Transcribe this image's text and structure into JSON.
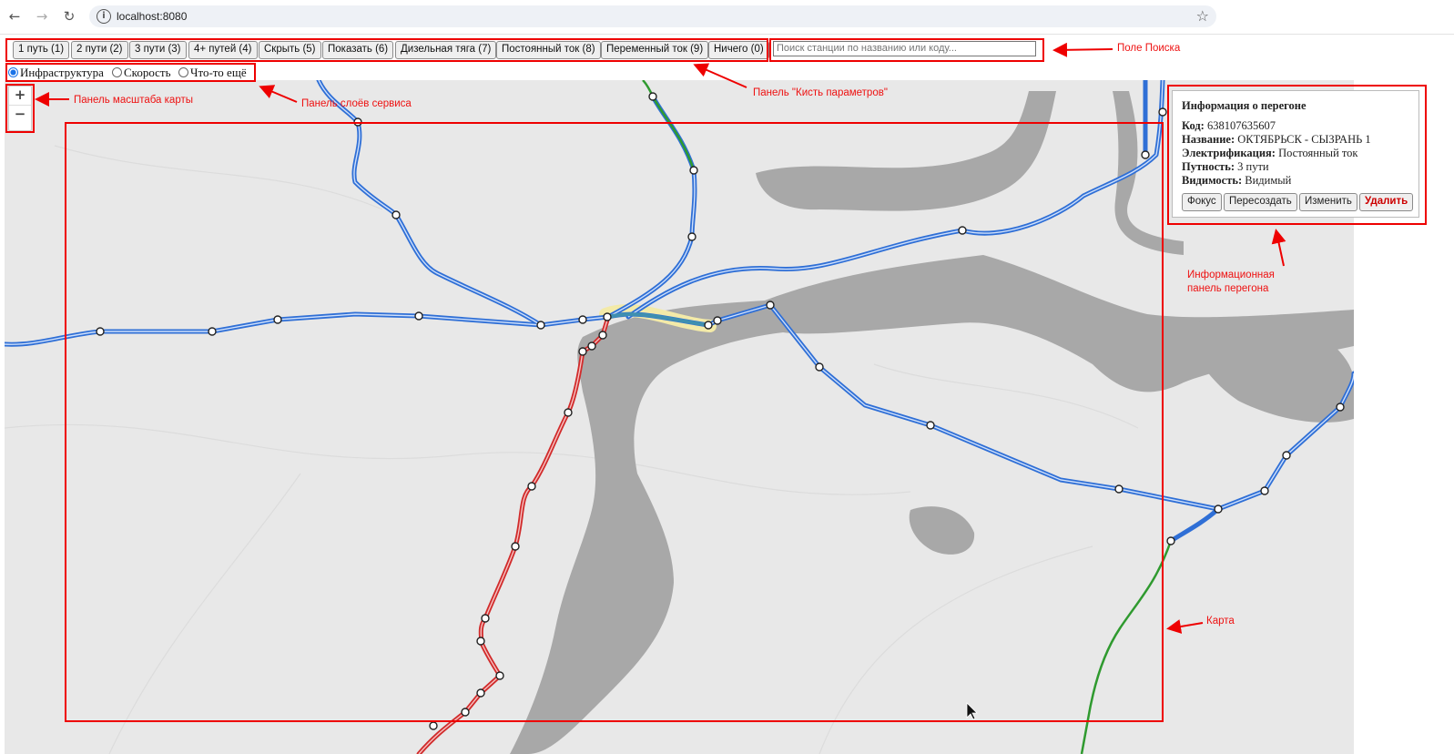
{
  "browser": {
    "back_icon": "arrow-left-icon",
    "forward_icon": "arrow-right-icon",
    "reload_icon": "reload-icon",
    "url": "localhost:8080",
    "bookmark_icon": "star-icon"
  },
  "toolbar": {
    "buttons": [
      "1 путь (1)",
      "2 пути (2)",
      "3 пути (3)",
      "4+ путей (4)",
      "Скрыть (5)",
      "Показать (6)",
      "Дизельная тяга (7)",
      "Постоянный ток (8)",
      "Переменный ток (9)",
      "Ничего (0)"
    ],
    "search_placeholder": "Поиск станции по названию или коду..."
  },
  "layers": {
    "options": [
      "Инфраструктура",
      "Скорость",
      "Что-то ещё"
    ],
    "selected": "Инфраструктура"
  },
  "zoom": {
    "plus": "+",
    "minus": "−"
  },
  "info_panel": {
    "title": "Информация о перегоне",
    "code_label": "Код:",
    "code": "638107635607",
    "name_label": "Название:",
    "name": "ОКТЯБРЬСК - СЫЗРАНЬ 1",
    "electrification_label": "Электрификация:",
    "electrification": "Постоянный ток",
    "tracks_label": "Путность:",
    "tracks": "3 пути",
    "visibility_label": "Видимость:",
    "visibility": "Видимый",
    "buttons": {
      "focus": "Фокус",
      "recreate": "Пересоздать",
      "edit": "Изменить",
      "delete": "Удалить"
    }
  },
  "annotations": {
    "search": "Поле Поиска",
    "brush": "Панель \"Кисть параметров\"",
    "zoom": "Панель масштаба карты",
    "layers": "Панель слоёв сервиса",
    "info": "Информационная панель перегона",
    "map": "Карта"
  },
  "colors": {
    "line_dc": "#2f6fd6",
    "line_diesel": "#d12b2b",
    "line_ac": "#2f9a2f",
    "annotation": "#e00000",
    "water": "#a6a6a6",
    "land": "#e8e8e8"
  }
}
